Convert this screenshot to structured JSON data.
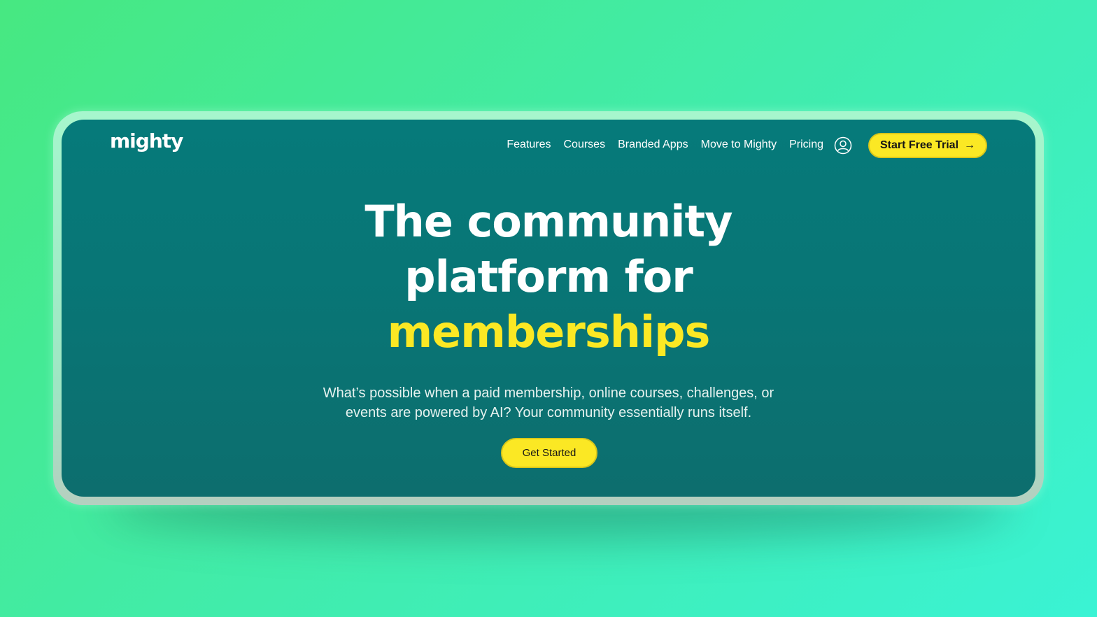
{
  "brand": {
    "logo_text": "mighty"
  },
  "nav": {
    "items": [
      {
        "label": "Features"
      },
      {
        "label": "Courses"
      },
      {
        "label": "Branded Apps"
      },
      {
        "label": "Move to Mighty"
      },
      {
        "label": "Pricing"
      }
    ],
    "account_icon": "user-circle-icon",
    "cta_label": "Start Free Trial",
    "cta_icon": "arrow-right-icon"
  },
  "hero": {
    "headline_line1": "The community",
    "headline_line2": "platform for",
    "headline_accent": "memberships",
    "subtext_line1": "What’s possible when a paid membership, online courses, challenges, or",
    "subtext_line2": "events are powered by AI? Your community essentially runs itself.",
    "cta_label": "Get Started"
  },
  "colors": {
    "accent_yellow": "#fbe824",
    "screen_teal": "#087676",
    "background_green": "#45ea95"
  }
}
